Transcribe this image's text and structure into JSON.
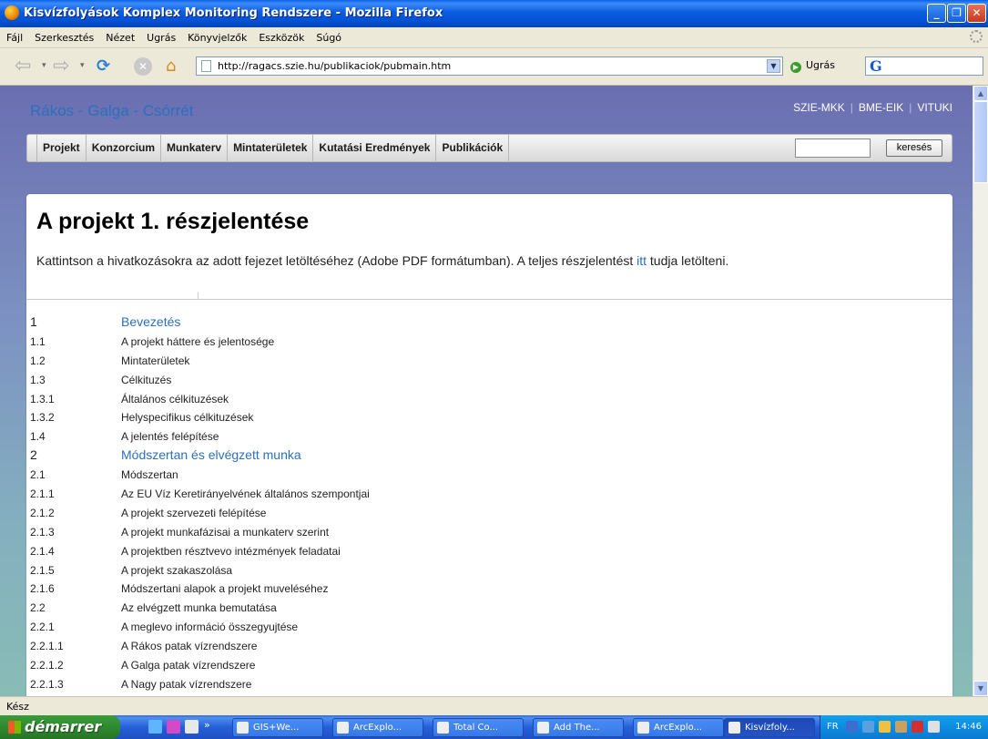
{
  "window": {
    "title": "Kisvízfolyások Komplex Monitoring Rendszere - Mozilla Firefox",
    "minimize_glyph": "_",
    "maximize_glyph": "❐",
    "close_glyph": "✕"
  },
  "menubar": {
    "items": [
      "Fájl",
      "Szerkesztés",
      "Nézet",
      "Ugrás",
      "Könyvjelzők",
      "Eszközök",
      "Súgó"
    ]
  },
  "toolbar": {
    "url": "http://ragacs.szie.hu/publikaciok/pubmain.htm",
    "go_label": "Ugrás",
    "google_glyph": "G"
  },
  "page": {
    "site_title": "Rákos - Galga - Csórrét",
    "top_links": [
      "SZIE-MKK",
      "BME-EIK",
      "VITUKI"
    ],
    "top_links_sep": "|",
    "nav": [
      "Projekt",
      "Konzorcium",
      "Munkaterv",
      "Mintaterületek",
      "Kutatási Eredmények",
      "Publikációk"
    ],
    "search_button": "keresés",
    "search_value": "",
    "heading": "A projekt 1. részjelentése",
    "intro_before": "Kattintson a hivatkozásokra az adott fejezet letöltéséhez (Adobe PDF formátumban). A teljes részjelentést ",
    "intro_link": "itt",
    "intro_after": " tudja letölteni.",
    "toc": [
      {
        "num": "1",
        "title": "Bevezetés",
        "major": true
      },
      {
        "num": "1.1",
        "title": "A projekt háttere és jelentosége",
        "major": false
      },
      {
        "num": "1.2",
        "title": "Mintaterületek",
        "major": false
      },
      {
        "num": "1.3",
        "title": "Célkituzés",
        "major": false
      },
      {
        "num": "1.3.1",
        "title": "Általános célkituzések",
        "major": false
      },
      {
        "num": "1.3.2",
        "title": "Helyspecifikus célkituzések",
        "major": false
      },
      {
        "num": "1.4",
        "title": "A jelentés felépítése",
        "major": false
      },
      {
        "num": "2",
        "title": "Módszertan és elvégzett munka",
        "major": true
      },
      {
        "num": "2.1",
        "title": "Módszertan",
        "major": false
      },
      {
        "num": "2.1.1",
        "title": "Az EU Víz Keretirányelvének általános szempontjai",
        "major": false
      },
      {
        "num": "2.1.2",
        "title": "A projekt szervezeti felépítése",
        "major": false
      },
      {
        "num": "2.1.3",
        "title": "A projekt munkafázisai a munkaterv szerint",
        "major": false
      },
      {
        "num": "2.1.4",
        "title": "A projektben résztvevo intézmények feladatai",
        "major": false
      },
      {
        "num": "2.1.5",
        "title": "A projekt szakaszolása",
        "major": false
      },
      {
        "num": "2.1.6",
        "title": "Módszertani alapok a projekt muveléséhez",
        "major": false
      },
      {
        "num": "2.2",
        "title": "Az elvégzett munka bemutatása",
        "major": false
      },
      {
        "num": "2.2.1",
        "title": "A meglevo információ összegyujtése",
        "major": false
      },
      {
        "num": "2.2.1.1",
        "title": "A Rákos patak vízrendszere",
        "major": false
      },
      {
        "num": "2.2.1.2",
        "title": "A Galga patak vízrendszere",
        "major": false
      },
      {
        "num": "2.2.1.3",
        "title": "A Nagy patak vízrendszere",
        "major": false
      }
    ]
  },
  "statusbar": {
    "text": "Kész"
  },
  "taskbar": {
    "start_label": "démarrer",
    "tasks": [
      {
        "label": "GIS+We...",
        "active": false
      },
      {
        "label": "ArcExplo...",
        "active": false
      },
      {
        "label": "Total Co...",
        "active": false
      },
      {
        "label": "Add The...",
        "active": false
      },
      {
        "label": "ArcExplo...",
        "active": false
      },
      {
        "label": "Kisvízfoly...",
        "active": true
      }
    ],
    "overflow_glyph": "»",
    "lang": "FR",
    "clock": "14:46"
  },
  "colors": {
    "link": "#2c6fbe",
    "titlebar": "#0a5ce0",
    "taskbar": "#2560d8",
    "start": "#3a9b3a"
  }
}
